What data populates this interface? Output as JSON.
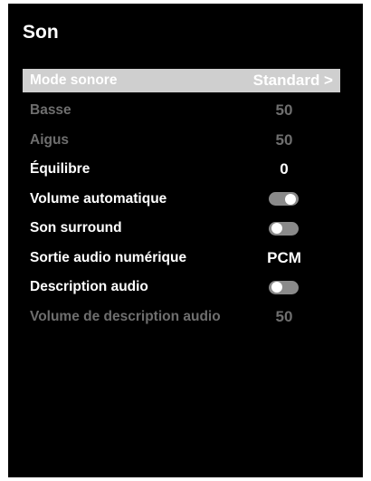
{
  "page": {
    "title": "Son"
  },
  "menu": {
    "items": [
      {
        "label": "Mode sonore",
        "value": "Standard >"
      },
      {
        "label": "Basse",
        "value": "50"
      },
      {
        "label": "Aigus",
        "value": "50"
      },
      {
        "label": "Équilibre",
        "value": "0"
      },
      {
        "label": "Volume automatique",
        "toggle": "on"
      },
      {
        "label": "Son surround",
        "toggle": "off"
      },
      {
        "label": "Sortie audio numérique",
        "value": "PCM"
      },
      {
        "label": "Description audio",
        "toggle": "off"
      },
      {
        "label": "Volume de description audio",
        "value": "50"
      }
    ]
  },
  "colors": {
    "background": "#000000",
    "selected_row": "#cfcfcf",
    "text": "#ffffff",
    "disabled_text": "#6e6e6e",
    "toggle_track": "#8a8a8a"
  }
}
